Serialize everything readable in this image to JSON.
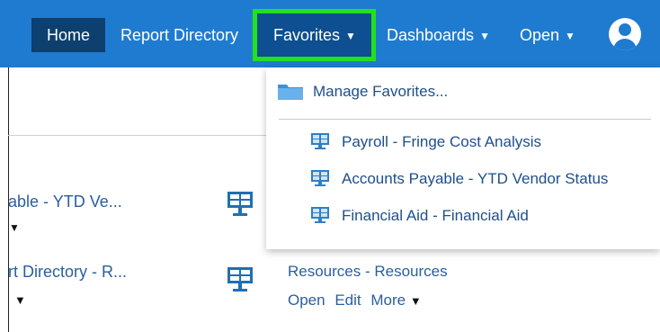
{
  "nav": {
    "home": "Home",
    "report_directory": "Report Directory",
    "favorites": "Favorites",
    "dashboards": "Dashboards",
    "open": "Open",
    "caret": "▼"
  },
  "background": {
    "item1_title": "able - YTD Ve...",
    "item2_title": "rt Directory - R...",
    "item3_title": "Resources - Resources",
    "item3_actions": {
      "open": "Open",
      "edit": "Edit",
      "more": "More"
    },
    "more_caret": "▼"
  },
  "favorites_menu": {
    "manage": "Manage Favorites...",
    "items": [
      "Payroll - Fringe Cost Analysis",
      "Accounts Payable - YTD Vendor Status",
      "Financial Aid - Financial Aid"
    ]
  },
  "colors": {
    "nav_bg": "#1f7bd0",
    "home_bg": "#0d3f6f",
    "highlight": "#22e11d",
    "link": "#1e4f8c"
  },
  "icons": {
    "user": "user-avatar-icon",
    "folder": "folder-icon",
    "report": "dashboard-monitor-icon"
  }
}
